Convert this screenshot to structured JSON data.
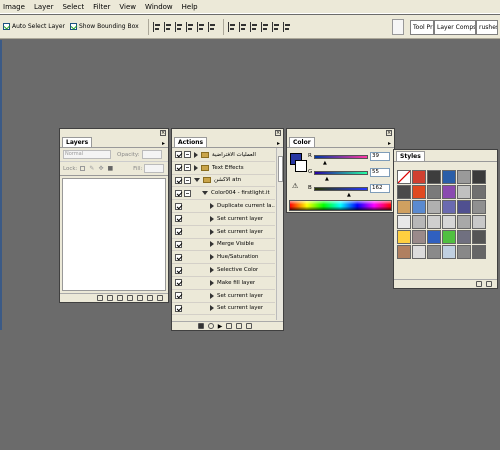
{
  "menu": [
    "Image",
    "Layer",
    "Select",
    "Filter",
    "View",
    "Window",
    "Help"
  ],
  "options": {
    "auto_select_label": "Auto Select Layer",
    "bounding_box_label": "Show Bounding Box"
  },
  "palette_well": {
    "tabs": [
      "Tool Pr",
      "Layer Comps",
      "rushes"
    ]
  },
  "layers": {
    "tab": "Layers",
    "blend_mode": "Normal",
    "opacity_label": "Opacity:",
    "lock_label": "Lock:",
    "fill_label": "Fill:"
  },
  "actions": {
    "tab": "Actions",
    "rows": [
      {
        "label": "العمليات الافتراضية",
        "level": 0,
        "kind": "set",
        "expanded": false
      },
      {
        "label": "Text Effects",
        "level": 0,
        "kind": "set",
        "expanded": false
      },
      {
        "label": "الأكشن atn",
        "level": 0,
        "kind": "set",
        "expanded": true
      },
      {
        "label": "Color004 - firstlight.it",
        "level": 1,
        "kind": "action",
        "expanded": true
      },
      {
        "label": "Duplicate current la...",
        "level": 2,
        "kind": "step"
      },
      {
        "label": "Set current layer",
        "level": 2,
        "kind": "step"
      },
      {
        "label": "Set current layer",
        "level": 2,
        "kind": "step"
      },
      {
        "label": "Merge Visible",
        "level": 2,
        "kind": "step"
      },
      {
        "label": "Hue/Saturation",
        "level": 2,
        "kind": "step"
      },
      {
        "label": "Selective Color",
        "level": 2,
        "kind": "step"
      },
      {
        "label": "Make fill layer",
        "level": 2,
        "kind": "step"
      },
      {
        "label": "Set current layer",
        "level": 2,
        "kind": "step"
      },
      {
        "label": "Set current layer",
        "level": 2,
        "kind": "step"
      }
    ]
  },
  "color": {
    "tab": "Color",
    "r_label": "R",
    "g_label": "G",
    "b_label": "B",
    "r": "39",
    "g": "55",
    "b": "162",
    "foreground": "#2737a2"
  },
  "styles": {
    "tab": "Styles",
    "swatches": [
      "#ffffff",
      "#d04030",
      "#3d3d3d",
      "#2a5ea8",
      "#9a9a9a",
      "#3b3b3b",
      "#4a4a4a",
      "#e04a20",
      "#7a7a7a",
      "#8a4ab0",
      "#c0c0c0",
      "#707070",
      "#d0a060",
      "#5a8ad0",
      "#b0b0b0",
      "#6a6ab0",
      "#505090",
      "#909090",
      "#e8e8e8",
      "#b8b8b8",
      "#cfcfcf",
      "#d6d6d6",
      "#a8a8a8",
      "#c8c8c8",
      "#ffd040",
      "#9a8a8a",
      "#3060c0",
      "#50c040",
      "#707080",
      "#555555",
      "#b08060",
      "#dcdcdc",
      "#8a8a8a",
      "#c0d0e0",
      "#888888",
      "#666666"
    ]
  }
}
